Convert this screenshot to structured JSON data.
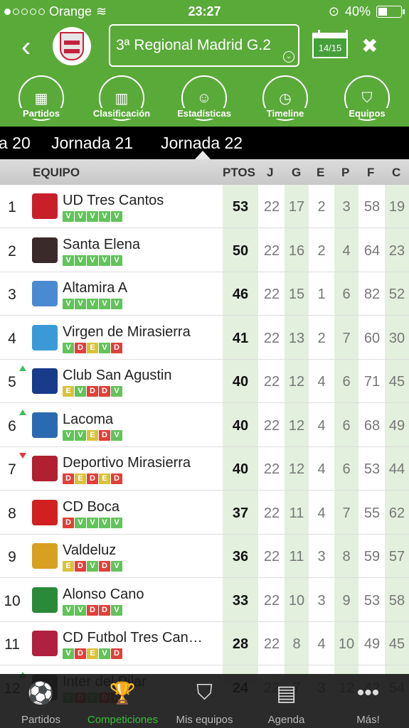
{
  "status": {
    "carrier": "Orange",
    "time": "23:27",
    "battery": "40%",
    "signal_bars": 1,
    "battery_level": 0.4
  },
  "header": {
    "league": "3ª Regional Madrid G.2",
    "calendar": "14/15",
    "nav": [
      {
        "label": "Partidos",
        "icon": "scoreboard-icon"
      },
      {
        "label": "Clasificación",
        "icon": "podium-icon"
      },
      {
        "label": "Estadísticas",
        "icon": "player-stats-icon"
      },
      {
        "label": "Timeline",
        "icon": "timeline-clock-icon"
      },
      {
        "label": "Equipos",
        "icon": "team-shield-icon"
      }
    ]
  },
  "jornadas": [
    "a 20",
    "Jornada 21",
    "Jornada 22"
  ],
  "table": {
    "columns": [
      "EQUIPO",
      "PTOS",
      "J",
      "G",
      "E",
      "P",
      "F",
      "C"
    ],
    "rows": [
      {
        "pos": "1",
        "team": "UD Tres Cantos",
        "form": [
          "V",
          "V",
          "V",
          "V",
          "V"
        ],
        "pts": "53",
        "j": "22",
        "g": "17",
        "e": "2",
        "p": "3",
        "f": "58",
        "c": "19",
        "trend": "",
        "logo_color": "#c8202a"
      },
      {
        "pos": "2",
        "team": "Santa Elena",
        "form": [
          "V",
          "V",
          "V",
          "V",
          "V"
        ],
        "pts": "50",
        "j": "22",
        "g": "16",
        "e": "2",
        "p": "4",
        "f": "64",
        "c": "23",
        "trend": "",
        "logo_color": "#3a2a2a"
      },
      {
        "pos": "3",
        "team": "Altamira A",
        "form": [
          "V",
          "V",
          "V",
          "V",
          "V"
        ],
        "pts": "46",
        "j": "22",
        "g": "15",
        "e": "1",
        "p": "6",
        "f": "82",
        "c": "52",
        "trend": "",
        "logo_color": "#4a8ad0"
      },
      {
        "pos": "4",
        "team": "Virgen de Mirasierra",
        "form": [
          "V",
          "D",
          "E",
          "V",
          "D"
        ],
        "pts": "41",
        "j": "22",
        "g": "13",
        "e": "2",
        "p": "7",
        "f": "60",
        "c": "30",
        "trend": "",
        "logo_color": "#3a9ad8"
      },
      {
        "pos": "5",
        "team": "Club San Agustin",
        "form": [
          "E",
          "V",
          "D",
          "D",
          "V"
        ],
        "pts": "40",
        "j": "22",
        "g": "12",
        "e": "4",
        "p": "6",
        "f": "71",
        "c": "45",
        "trend": "up",
        "logo_color": "#1a3a8a"
      },
      {
        "pos": "6",
        "team": "Lacoma",
        "form": [
          "V",
          "V",
          "E",
          "D",
          "V"
        ],
        "pts": "40",
        "j": "22",
        "g": "12",
        "e": "4",
        "p": "6",
        "f": "68",
        "c": "49",
        "trend": "up",
        "logo_color": "#2a6ab0"
      },
      {
        "pos": "7",
        "team": "Deportivo Mirasierra",
        "form": [
          "D",
          "E",
          "D",
          "E",
          "D"
        ],
        "pts": "40",
        "j": "22",
        "g": "12",
        "e": "4",
        "p": "6",
        "f": "53",
        "c": "44",
        "trend": "down",
        "logo_color": "#b02030"
      },
      {
        "pos": "8",
        "team": "CD Boca",
        "form": [
          "D",
          "V",
          "V",
          "V",
          "V"
        ],
        "pts": "37",
        "j": "22",
        "g": "11",
        "e": "4",
        "p": "7",
        "f": "55",
        "c": "62",
        "trend": "",
        "logo_color": "#d02020"
      },
      {
        "pos": "9",
        "team": "Valdeluz",
        "form": [
          "E",
          "D",
          "V",
          "D",
          "V"
        ],
        "pts": "36",
        "j": "22",
        "g": "11",
        "e": "3",
        "p": "8",
        "f": "59",
        "c": "57",
        "trend": "",
        "logo_color": "#d8a020"
      },
      {
        "pos": "10",
        "team": "Alonso Cano",
        "form": [
          "V",
          "V",
          "D",
          "D",
          "V"
        ],
        "pts": "33",
        "j": "22",
        "g": "10",
        "e": "3",
        "p": "9",
        "f": "53",
        "c": "58",
        "trend": "",
        "logo_color": "#2a8a3a"
      },
      {
        "pos": "11",
        "team": "CD Futbol Tres Can…",
        "form": [
          "V",
          "D",
          "E",
          "V",
          "D"
        ],
        "pts": "28",
        "j": "22",
        "g": "8",
        "e": "4",
        "p": "10",
        "f": "49",
        "c": "45",
        "trend": "",
        "logo_color": "#b02040"
      },
      {
        "pos": "12",
        "team": "Inter del Pilar",
        "form": [
          "V",
          "D",
          "V",
          "D",
          "D"
        ],
        "pts": "24",
        "j": "22",
        "g": "7",
        "e": "3",
        "p": "12",
        "f": "42",
        "c": "54",
        "trend": "up",
        "logo_color": "#444"
      }
    ]
  },
  "tabbar": [
    {
      "label": "Partidos",
      "icon": "soccer-ball-icon",
      "active": false
    },
    {
      "label": "Competiciones",
      "icon": "trophy-icon",
      "active": true
    },
    {
      "label": "Mis equipos",
      "icon": "shield-ball-icon",
      "active": false
    },
    {
      "label": "Agenda",
      "icon": "agenda-icon",
      "active": false
    },
    {
      "label": "Más!",
      "icon": "more-dots-icon",
      "active": false
    }
  ]
}
